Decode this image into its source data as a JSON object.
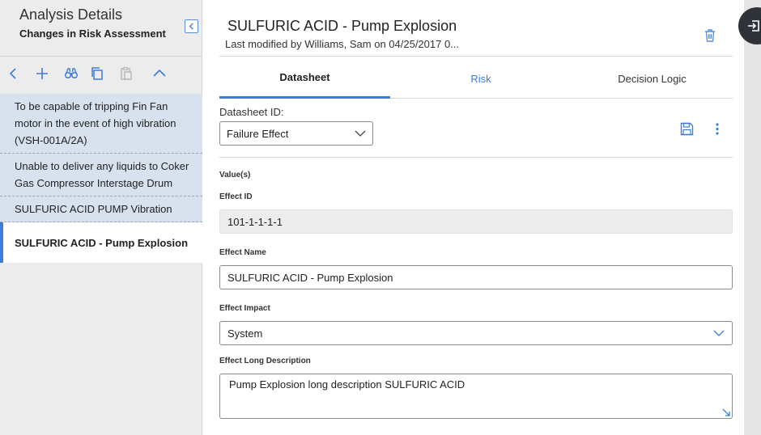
{
  "sidebar": {
    "title": "Analysis Details",
    "subtitle": "Changes in Risk Assessment",
    "items": [
      {
        "label": "To be capable of tripping Fin Fan motor in the event of high vibration (VSH-001A/2A)"
      },
      {
        "label": "Unable to deliver any liquids to Coker Gas Compressor Interstage Drum"
      },
      {
        "label": "SULFURIC ACID PUMP Vibration"
      },
      {
        "label": "SULFURIC ACID - Pump Explosion"
      }
    ]
  },
  "header": {
    "title": "SULFURIC ACID - Pump Explosion",
    "modified": "Last modified by Williams, Sam on 04/25/2017 0..."
  },
  "tabs": [
    {
      "label": "Datasheet",
      "selected": true
    },
    {
      "label": "Risk"
    },
    {
      "label": "Decision Logic"
    }
  ],
  "datasheet": {
    "id_label": "Datasheet ID:",
    "id_value": "Failure Effect",
    "section_label": "Value(s)",
    "fields": {
      "effect_id": {
        "label": "Effect ID",
        "value": "101-1-1-1-1"
      },
      "effect_name": {
        "label": "Effect Name",
        "value": "SULFURIC ACID - Pump Explosion"
      },
      "effect_impact": {
        "label": "Effect Impact",
        "value": "System"
      },
      "effect_long_description": {
        "label": "Effect Long Description",
        "value": "Pump Explosion long description SULFURIC ACID"
      }
    }
  },
  "colors": {
    "accent": "#3b7ddb",
    "sidebar_item_bg": "#d7e2ee",
    "fab_bg": "#2d3338"
  }
}
